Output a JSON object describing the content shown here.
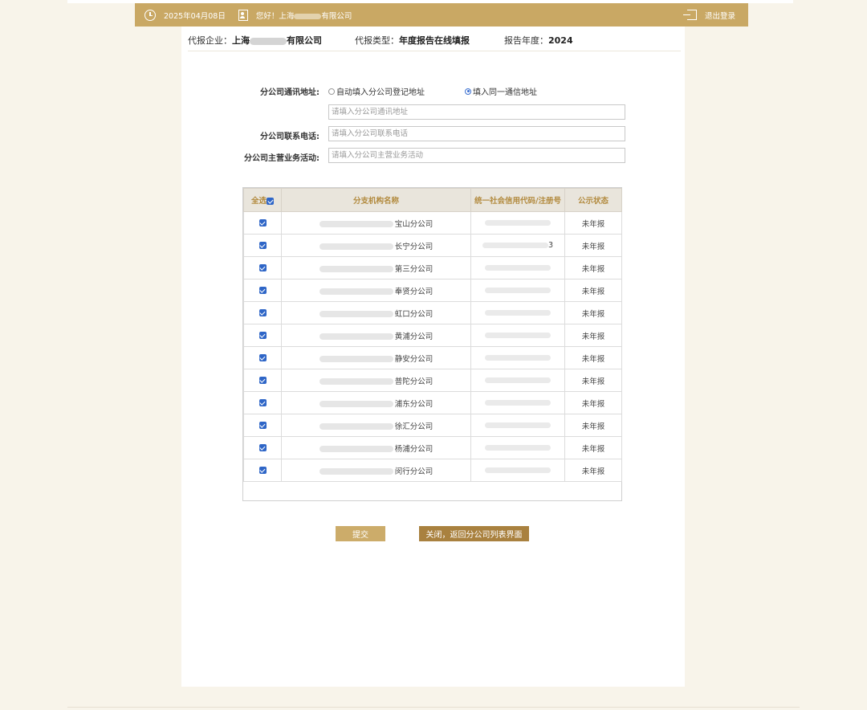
{
  "topbar": {
    "date": "2025年04月08日",
    "greeting_prefix": "您好！上海",
    "greeting_suffix": "有限公司",
    "logout_label": "退出登录"
  },
  "info": {
    "agent_label": "代报企业：",
    "agent_value_prefix": "上海",
    "agent_value_suffix": "有限公司",
    "type_label": "代报类型：",
    "type_value": "年度报告在线填报",
    "year_label": "报告年度：",
    "year_value": "2024"
  },
  "form": {
    "address_label": "分公司通讯地址:",
    "radio_auto": "自动填入分公司登记地址",
    "radio_same": "填入同一通信地址",
    "address_placeholder": "请填入分公司通讯地址",
    "phone_label": "分公司联系电话:",
    "phone_placeholder": "请填入分公司联系电话",
    "business_label": "分公司主营业务活动:",
    "business_placeholder": "请填入分公司主营业务活动"
  },
  "table": {
    "headers": {
      "select_all": "全选",
      "name": "分支机构名称",
      "code": "统一社会信用代码/注册号",
      "status": "公示状态"
    },
    "rows": [
      {
        "name_suffix": "宝山分公司",
        "code_suffix": "",
        "status": "未年报"
      },
      {
        "name_suffix": "长宁分公司",
        "code_suffix": "3",
        "status": "未年报"
      },
      {
        "name_suffix": "第三分公司",
        "code_suffix": "",
        "status": "未年报"
      },
      {
        "name_suffix": "奉贤分公司",
        "code_suffix": "",
        "status": "未年报"
      },
      {
        "name_suffix": "虹口分公司",
        "code_suffix": "",
        "status": "未年报"
      },
      {
        "name_suffix": "黄浦分公司",
        "code_suffix": "",
        "status": "未年报"
      },
      {
        "name_suffix": "静安分公司",
        "code_suffix": "",
        "status": "未年报"
      },
      {
        "name_suffix": "普陀分公司",
        "code_suffix": "",
        "status": "未年报"
      },
      {
        "name_suffix": "浦东分公司",
        "code_suffix": "",
        "status": "未年报"
      },
      {
        "name_suffix": "徐汇分公司",
        "code_suffix": "",
        "status": "未年报"
      },
      {
        "name_suffix": "杨浦分公司",
        "code_suffix": "",
        "status": "未年报"
      },
      {
        "name_suffix": "闵行分公司",
        "code_suffix": "",
        "status": "未年报"
      }
    ]
  },
  "buttons": {
    "submit": "提交",
    "close": "关闭，返回分公司列表界面"
  },
  "colors": {
    "accent": "#c9a864",
    "button_dark": "#a9813f",
    "checkbox": "#2f66c7"
  }
}
